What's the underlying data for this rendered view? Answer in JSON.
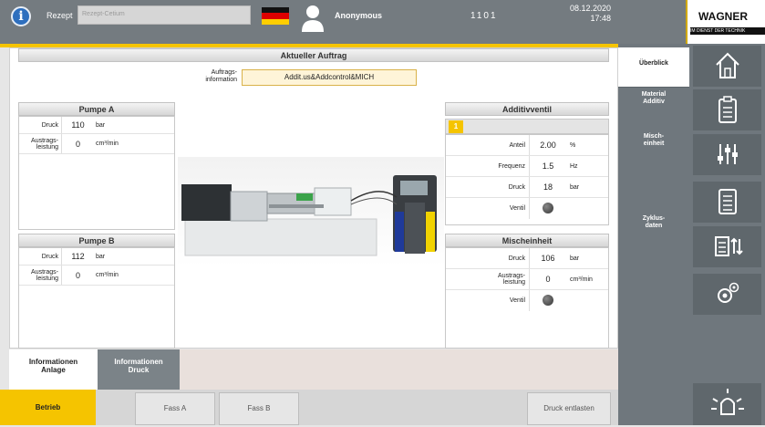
{
  "header": {
    "rezept_label": "Rezept",
    "rezept_value": "Rezept-Cetium",
    "user": "Anonymous",
    "code": "1101",
    "date": "08.12.2020",
    "time": "17:48",
    "brand": "WAGNER",
    "brand_sub": "IM DIENST DER TECHNIK",
    "flag_colors": [
      "#111111",
      "#dd0000",
      "#ffce00"
    ]
  },
  "auftrag": {
    "title": "Aktueller Auftrag",
    "label": "Auftrags-\ninformation",
    "value": "Addit.us&Addcontrol&MICH"
  },
  "pumpe_a": {
    "title": "Pumpe A",
    "druck_label": "Druck",
    "druck_value": "110",
    "druck_unit": "bar",
    "leistung_label": "Austrags-\nleistung",
    "leistung_value": "0",
    "leistung_unit": "cm³/min"
  },
  "pumpe_b": {
    "title": "Pumpe B",
    "druck_label": "Druck",
    "druck_value": "112",
    "druck_unit": "bar",
    "leistung_label": "Austrags-\nleistung",
    "leistung_value": "0",
    "leistung_unit": "cm³/min"
  },
  "additivventil": {
    "title": "Additivventil",
    "tab": "1",
    "anteil_label": "Anteil",
    "anteil_value": "2.00",
    "anteil_unit": "%",
    "frequenz_label": "Frequenz",
    "frequenz_value": "1.5",
    "frequenz_unit": "Hz",
    "druck_label": "Druck",
    "druck_value": "18",
    "druck_unit": "bar",
    "ventil_label": "Ventil"
  },
  "mischeinheit": {
    "title": "Mischeinheit",
    "druck_label": "Druck",
    "druck_value": "106",
    "druck_unit": "bar",
    "leistung_label": "Austrags-\nleistung",
    "leistung_value": "0",
    "leistung_unit": "cm³/min",
    "ventil_label": "Ventil"
  },
  "side_nav": [
    "Überblick",
    "Material\nAdditiv",
    "Misch-\neinheit",
    "Zyklus-\ndaten"
  ],
  "icons": [
    "home-icon",
    "clipboard-icon",
    "sliders-icon",
    "list-icon",
    "transfer-icon",
    "settings-icon",
    "alarm-icon"
  ],
  "bottom_tabs": [
    "Informationen\nAnlage",
    "Informationen\nDruck"
  ],
  "bottom_buttons": {
    "betrieb": "Betrieb",
    "fass_a": "Fass A",
    "fass_b": "Fass B",
    "entlasten": "Druck entlasten"
  }
}
